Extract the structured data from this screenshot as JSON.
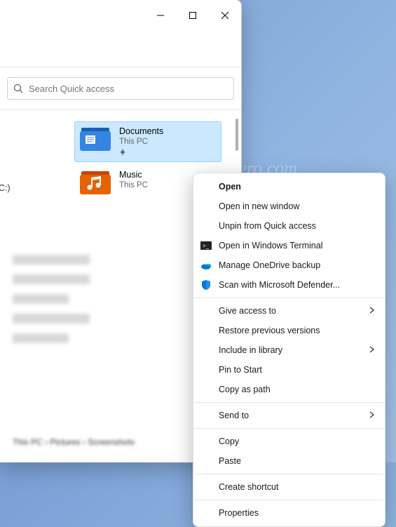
{
  "watermark": "winaero.com",
  "window": {
    "search_placeholder": "Search Quick access",
    "drive_label": "C:)"
  },
  "folders": [
    {
      "name": "Documents",
      "location": "This PC",
      "pinned": true
    },
    {
      "name": "Music",
      "location": "This PC",
      "pinned": false
    }
  ],
  "context_menu": {
    "groups": [
      [
        {
          "label": "Open",
          "id": "open",
          "bold": true,
          "submenu": false
        },
        {
          "label": "Open in new window",
          "id": "open-new-window",
          "submenu": false
        },
        {
          "label": "Unpin from Quick access",
          "id": "unpin-quick-access",
          "submenu": false
        },
        {
          "label": "Open in Windows Terminal",
          "id": "open-terminal",
          "icon": "terminal",
          "submenu": false
        },
        {
          "label": "Manage OneDrive backup",
          "id": "onedrive-backup",
          "icon": "onedrive",
          "submenu": false
        },
        {
          "label": "Scan with Microsoft Defender...",
          "id": "scan-defender",
          "icon": "defender",
          "submenu": false
        }
      ],
      [
        {
          "label": "Give access to",
          "id": "give-access",
          "submenu": true
        },
        {
          "label": "Restore previous versions",
          "id": "restore-versions",
          "submenu": false
        },
        {
          "label": "Include in library",
          "id": "include-library",
          "submenu": true
        },
        {
          "label": "Pin to Start",
          "id": "pin-start",
          "submenu": false
        },
        {
          "label": "Copy as path",
          "id": "copy-as-path",
          "submenu": false
        }
      ],
      [
        {
          "label": "Send to",
          "id": "send-to",
          "submenu": true
        }
      ],
      [
        {
          "label": "Copy",
          "id": "copy",
          "submenu": false
        },
        {
          "label": "Paste",
          "id": "paste",
          "submenu": false
        }
      ],
      [
        {
          "label": "Create shortcut",
          "id": "create-shortcut",
          "submenu": false
        }
      ],
      [
        {
          "label": "Properties",
          "id": "properties",
          "submenu": false
        }
      ]
    ]
  }
}
